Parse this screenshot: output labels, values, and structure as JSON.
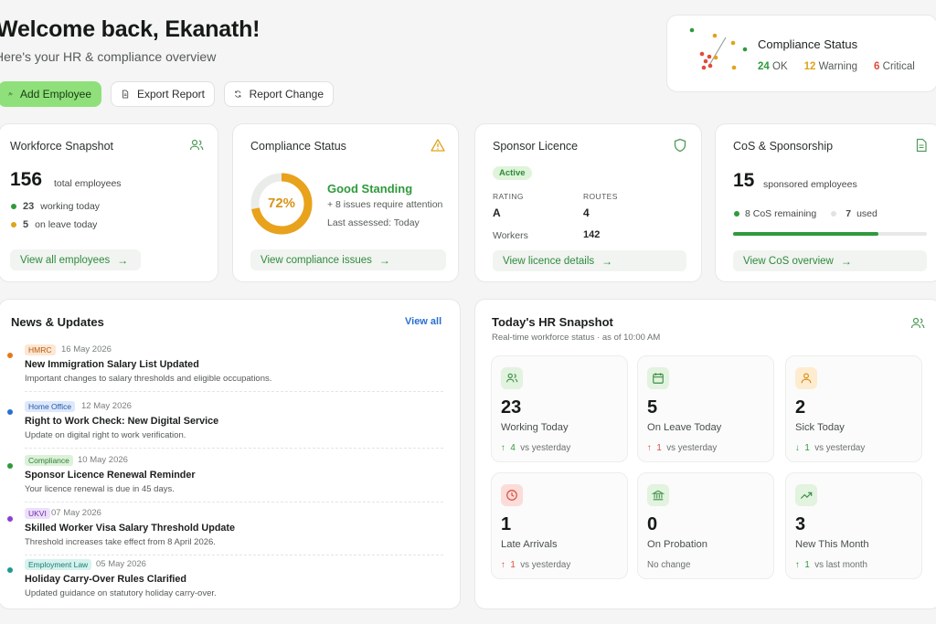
{
  "header": {
    "welcome": "Welcome back, Ekanath!",
    "subtitle": "Here's your HR & compliance overview",
    "buttons": {
      "add": "Add Employee",
      "export": "Export Report",
      "report": "Report Change"
    }
  },
  "status_popup": {
    "title": "Compliance Status",
    "ok_num": "24",
    "ok_label": "OK",
    "warn_num": "12",
    "warn_label": "Warning",
    "crit_num": "6",
    "crit_label": "Critical"
  },
  "workforce": {
    "title": "Workforce Snapshot",
    "total": "156",
    "total_label": "total employees",
    "working_num": "23",
    "working_label": "working today",
    "leave_num": "5",
    "leave_label": "on leave today",
    "link": "View all employees"
  },
  "compliance": {
    "title": "Compliance Status",
    "percent": "72%",
    "percent_value": 72,
    "standing": "Good Standing",
    "issues": "+ 8 issues require attention",
    "assessed": "Last assessed: Today",
    "link": "View compliance issues"
  },
  "licence": {
    "title": "Sponsor Licence",
    "badge": "Active",
    "rating_label": "RATING",
    "rating_value": "A",
    "routes_label": "ROUTES",
    "routes_value": "4",
    "workers_label": "Workers",
    "workers_value": "142",
    "link": "View licence details"
  },
  "cos": {
    "title": "CoS & Sponsorship",
    "sponsored": "15",
    "sponsored_label": "sponsored employees",
    "remaining": "8 CoS remaining",
    "used_num": "7",
    "used_label": "used",
    "progress": 0.75,
    "link": "View CoS overview"
  },
  "news": {
    "title": "News & Updates",
    "view_all": "View all",
    "items": [
      {
        "tag": "HMRC",
        "date": "16 May 2026",
        "headline": "New Immigration Salary List Updated",
        "desc": "Important changes to salary thresholds and eligible occupations."
      },
      {
        "tag": "Home Office",
        "date": "12 May 2026",
        "headline": "Right to Work Check: New Digital Service",
        "desc": "Update on digital right to work verification."
      },
      {
        "tag": "Compliance",
        "date": "10 May 2026",
        "headline": "Sponsor Licence Renewal Reminder",
        "desc": "Your licence renewal is due in 45 days."
      },
      {
        "tag": "UKVI",
        "date": "07 May 2026",
        "headline": "Skilled Worker Visa Salary Threshold Update",
        "desc": "Threshold increases take effect from 8 April 2026."
      },
      {
        "tag": "Employment Law",
        "date": "05 May 2026",
        "headline": "Holiday Carry-Over Rules Clarified",
        "desc": "Updated guidance on statutory holiday carry-over."
      }
    ]
  },
  "snapshot": {
    "title": "Today's HR Snapshot",
    "subtitle": "Real-time workforce status · as of 10:00 AM",
    "tiles": [
      {
        "num": "23",
        "label": "Working Today",
        "arrow": "↑",
        "delta": "4",
        "foot": "vs yesterday"
      },
      {
        "num": "5",
        "label": "On Leave Today",
        "arrow": "↑",
        "delta": "1",
        "foot": "vs yesterday"
      },
      {
        "num": "2",
        "label": "Sick Today",
        "arrow": "↓",
        "delta": "1",
        "foot": "vs yesterday"
      },
      {
        "num": "1",
        "label": "Late Arrivals",
        "arrow": "↑",
        "delta": "1",
        "foot": "vs yesterday"
      },
      {
        "num": "0",
        "label": "On Probation",
        "foot": "No change"
      },
      {
        "num": "3",
        "label": "New This Month",
        "arrow": "↑",
        "delta": "1",
        "foot": "vs last month"
      }
    ]
  }
}
